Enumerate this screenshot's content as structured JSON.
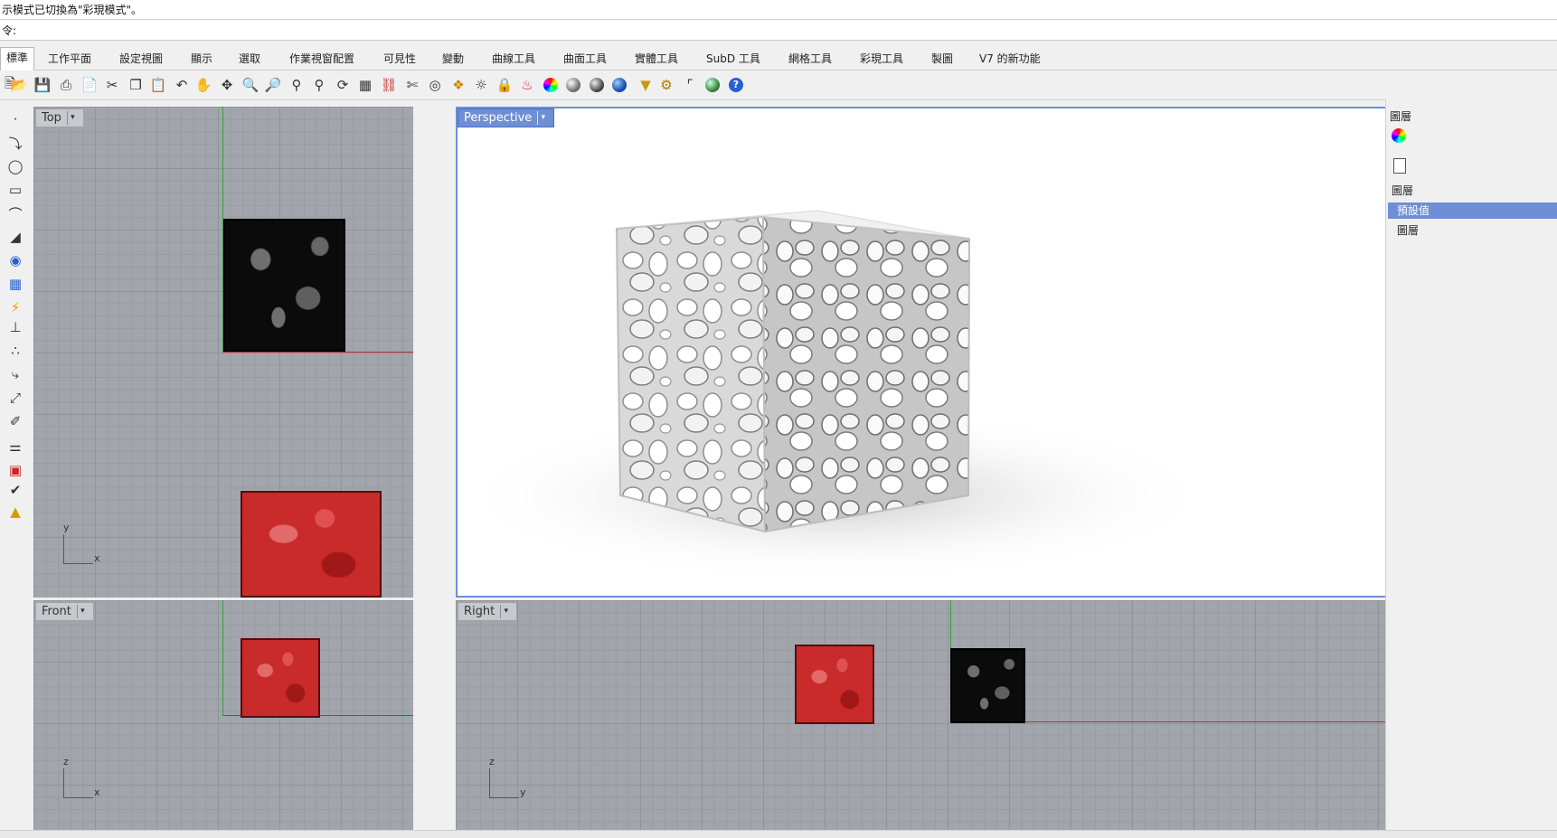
{
  "command": {
    "history": "示模式已切換為\"彩現模式\"。",
    "prompt": "令:"
  },
  "tabs": [
    {
      "label": "標準",
      "active": true
    },
    {
      "label": "工作平面"
    },
    {
      "label": "設定視圖"
    },
    {
      "label": "顯示"
    },
    {
      "label": "選取"
    },
    {
      "label": "作業視窗配置"
    },
    {
      "label": "可見性"
    },
    {
      "label": "變動"
    },
    {
      "label": "曲線工具"
    },
    {
      "label": "曲面工具"
    },
    {
      "label": "實體工具"
    },
    {
      "label": "SubD 工具"
    },
    {
      "label": "網格工具"
    },
    {
      "label": "彩現工具"
    },
    {
      "label": "製圖"
    },
    {
      "label": "V7 的新功能"
    }
  ],
  "toolbar_icons": [
    "new-file-icon",
    "open-folder-icon",
    "save-icon",
    "print-icon",
    "import-icon",
    "cut-icon",
    "copy-icon",
    "paste-icon",
    "undo-icon",
    "pan-hand-icon",
    "move-view-icon",
    "zoom-icon",
    "zoom-window-icon",
    "zoom-extents-icon",
    "zoom-selected-icon",
    "rotate-view-icon",
    "viewport-layout-icon",
    "car-icon",
    "scissors-icon",
    "target-icon",
    "snap-icon",
    "light-bulb-icon",
    "lock-icon",
    "paint-bucket-icon",
    "color-wheel-icon",
    "sphere-gray-icon",
    "sphere-shaded-icon",
    "sphere-blue-icon",
    "filter-icon",
    "gear-icon",
    "dimension-icon",
    "globe-icon",
    "help-icon"
  ],
  "viewports": {
    "top": {
      "label": "Top",
      "axis_a": "y",
      "axis_b": "x"
    },
    "perspective": {
      "label": "Perspective"
    },
    "front": {
      "label": "Front",
      "axis_a": "z",
      "axis_b": "x"
    },
    "right": {
      "label": "Right",
      "axis_a": "z",
      "axis_b": "y"
    }
  },
  "right_panel": {
    "title": "圖層",
    "header": "圖層",
    "selected_layer": "預設值",
    "layer_item": "圖層"
  },
  "colors": {
    "viewport_active": "#6e8fd6",
    "x_axis": "#b83232",
    "y_axis": "#2e9e3a",
    "object_red": "#c92a2a",
    "object_black": "#0b0b0b",
    "grid_bg": "#a2a6ac"
  }
}
